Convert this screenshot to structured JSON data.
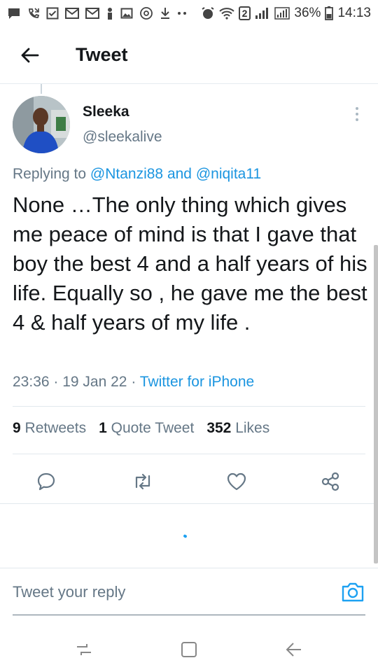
{
  "status_bar": {
    "battery": "36%",
    "time": "14:13",
    "notification_count": "2"
  },
  "app_bar": {
    "title": "Tweet"
  },
  "tweet": {
    "display_name": "Sleeka",
    "handle": "@sleekalive",
    "replying_prefix": "Replying to ",
    "reply_mention_1": "@Ntanzi88",
    "reply_joiner": " and ",
    "reply_mention_2": "@niqita11",
    "text": "None …The only thing which gives me peace of mind is that I gave that boy the best 4 and a half years of his life. Equally so , he gave me the best 4 & half years of my life .",
    "time": "23:36",
    "date": "19 Jan 22",
    "separator": " · ",
    "source": "Twitter for iPhone"
  },
  "stats": {
    "retweets_count": "9",
    "retweets_label": "Retweets",
    "quotes_count": "1",
    "quotes_label": "Quote Tweet",
    "likes_count": "352",
    "likes_label": "Likes"
  },
  "reply": {
    "placeholder": "Tweet your reply"
  },
  "colors": {
    "accent": "#1b95e0",
    "muted": "#657786",
    "text": "#14171a",
    "divider": "#e1e8ed"
  },
  "icons": {
    "back": "arrow-left-icon",
    "more": "more-vertical-icon",
    "reply": "comment-icon",
    "retweet": "retweet-icon",
    "like": "heart-icon",
    "share": "share-icon",
    "camera": "camera-icon",
    "nav_recents": "recents-icon",
    "nav_home": "home-icon",
    "nav_back": "nav-back-icon"
  }
}
